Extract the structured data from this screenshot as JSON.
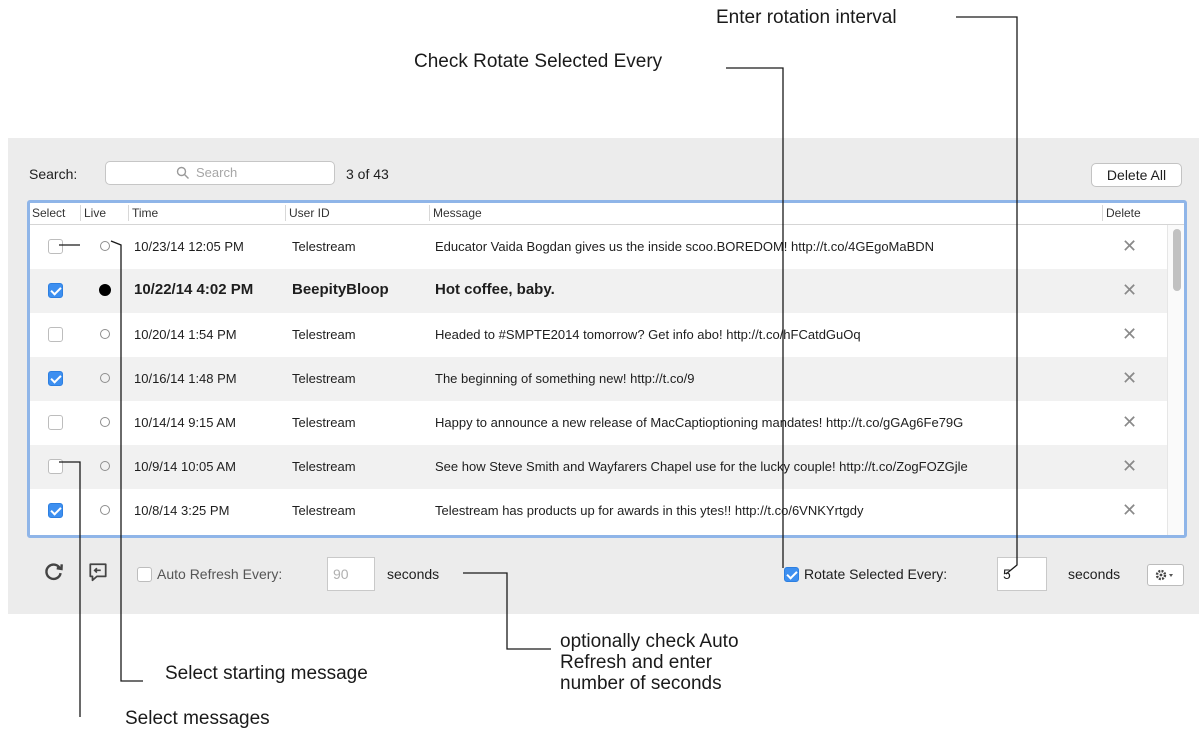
{
  "callouts": {
    "rotation_interval": "Enter rotation interval",
    "check_rotate": "Check Rotate Selected Every",
    "select_starting": "Select starting message",
    "auto_refresh": [
      "optionally check Auto",
      "Refresh and enter",
      "number of seconds"
    ],
    "select_messages": "Select messages"
  },
  "toolbar": {
    "search_label": "Search:",
    "search_placeholder": "Search",
    "count": "3 of 43",
    "delete_all": "Delete All"
  },
  "table": {
    "columns": [
      "Select",
      "Live",
      "Time",
      "User ID",
      "Message",
      "Delete"
    ],
    "rows": [
      {
        "selected": false,
        "live": false,
        "time": "10/23/14 12:05 PM",
        "user": "Telestream",
        "message": "Educator Vaida Bogdan gives us the inside scoo.BOREDOM! http://t.co/4GEgoMaBDN",
        "delete": "✕"
      },
      {
        "selected": true,
        "live": true,
        "time": "10/22/14 4:02 PM",
        "user": "BeepityBloop",
        "message": "Hot coffee, baby.",
        "delete": "✕"
      },
      {
        "selected": false,
        "live": false,
        "time": "10/20/14 1:54 PM",
        "user": "Telestream",
        "message": "Headed to #SMPTE2014 tomorrow? Get info abo! http://t.co/hFCatdGuOq",
        "delete": "✕"
      },
      {
        "selected": true,
        "live": false,
        "time": "10/16/14 1:48 PM",
        "user": "Telestream",
        "message": "The beginning of something new! http://t.co/9",
        "delete": "✕"
      },
      {
        "selected": false,
        "live": false,
        "time": "10/14/14 9:15 AM",
        "user": "Telestream",
        "message": "Happy to announce a new release of MacCaptioptioning mandates! http://t.co/gGAg6Fe79G",
        "delete": "✕"
      },
      {
        "selected": false,
        "live": false,
        "time": "10/9/14 10:05 AM",
        "user": "Telestream",
        "message": "See how Steve Smith and Wayfarers Chapel use for the lucky couple! http://t.co/ZogFOZGjle",
        "delete": "✕"
      },
      {
        "selected": true,
        "live": false,
        "time": "10/8/14 3:25 PM",
        "user": "Telestream",
        "message": "Telestream has products up for awards in this ytes!! http://t.co/6VNKYrtgdy",
        "delete": "✕"
      }
    ]
  },
  "footer": {
    "auto_refresh_label": "Auto Refresh Every:",
    "auto_refresh_checked": false,
    "auto_refresh_value": "90",
    "seconds_1": "seconds",
    "rotate_label": "Rotate Selected Every:",
    "rotate_checked": true,
    "rotate_value": "5",
    "seconds_2": "seconds"
  },
  "icons": [
    "refresh-icon",
    "message-back-icon",
    "gear-icon",
    "search-icon",
    "close-icon"
  ],
  "colors": {
    "accent": "#3d8ff0",
    "table_border": "#8fb5e8"
  }
}
